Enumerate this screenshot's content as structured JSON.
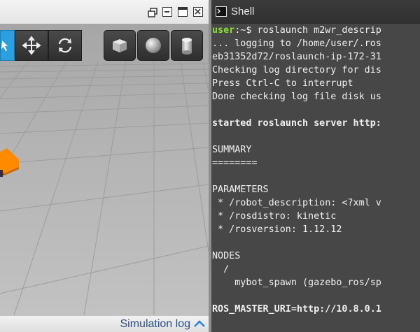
{
  "simulation": {
    "window_buttons": [
      "restore-icon",
      "minimize-icon",
      "maximize-icon",
      "close-icon"
    ],
    "toolbar": {
      "tools": [
        "select-mode-icon",
        "translate-mode-icon",
        "rotate-mode-icon"
      ],
      "shapes": [
        "box-shape-icon",
        "sphere-shape-icon",
        "cylinder-shape-icon"
      ],
      "active_color": "#2b9fe0"
    },
    "footer": {
      "label": "Simulation log"
    },
    "ground_color": "#b9b9b9",
    "robot_color": "#ff8c00"
  },
  "shell": {
    "title": "Shell",
    "prompt_user": "user",
    "prompt_rest": ":~$ roslaunch m2wr_descrip",
    "lines": [
      "... logging to /home/user/.ros",
      "eb31352d72/roslaunch-ip-172-31",
      "Checking log directory for dis",
      "Press Ctrl-C to interrupt",
      "Done checking log file disk us",
      "",
      "started roslaunch server http:",
      "",
      "SUMMARY",
      "========",
      "",
      "PARAMETERS",
      " * /robot_description: <?xml v",
      " * /rosdistro: kinetic",
      " * /rosversion: 1.12.12",
      "",
      "NODES",
      "  /",
      "    mybot_spawn (gazebo_ros/sp",
      "",
      "ROS_MASTER_URI=http://10.8.0.1"
    ]
  }
}
